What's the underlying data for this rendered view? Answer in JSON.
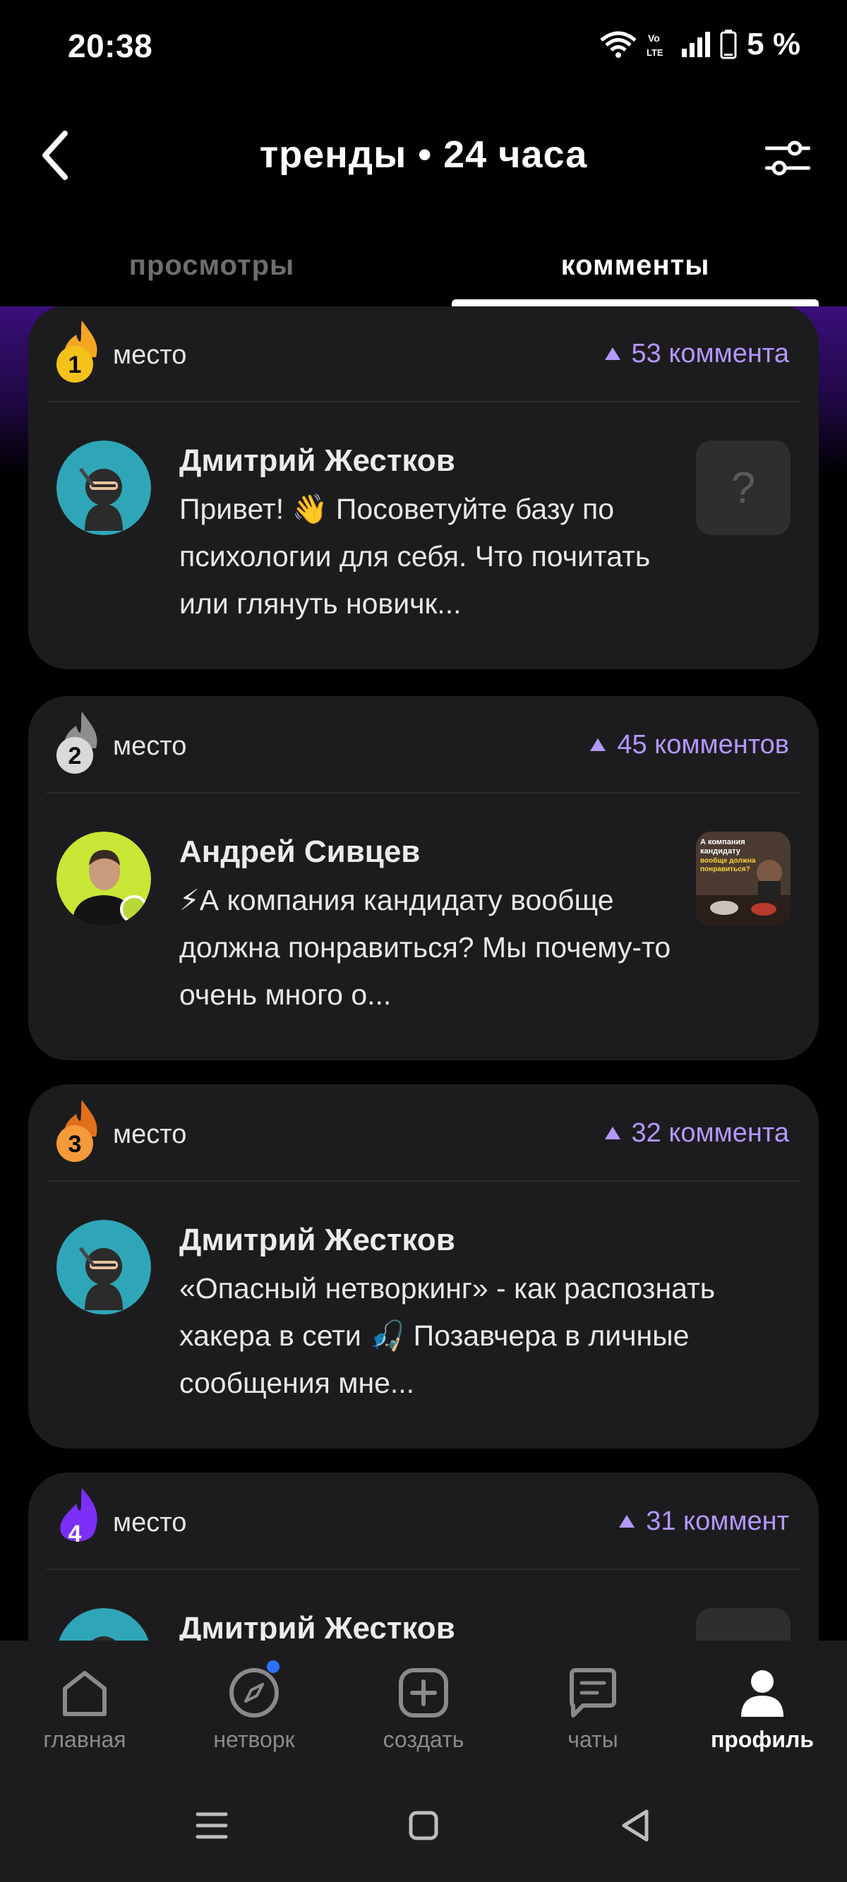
{
  "status": {
    "time": "20:38",
    "battery": "5 %",
    "network_label": "Vo LTE"
  },
  "header": {
    "title": "тренды • 24 часа"
  },
  "tabs": [
    {
      "label": "просмотры",
      "active": false
    },
    {
      "label": "комменты",
      "active": true
    }
  ],
  "place_label": "место",
  "cards": [
    {
      "rank": "1",
      "comments": "53 коммента",
      "author": "Дмитрий Жестков",
      "text": "Привет! 👋 Посоветуйте базу по психологии для себя. Что почитать или глянуть новичк...",
      "thumb": "?"
    },
    {
      "rank": "2",
      "comments": "45 комментов",
      "author": "Андрей Сивцев",
      "text": "⚡А компания кандидату вообще должна понравиться? Мы почему-то очень много о...",
      "thumb_text": "А компания кандидату вообще должна понравиться?"
    },
    {
      "rank": "3",
      "comments": "32 коммента",
      "author": "Дмитрий Жестков",
      "text": "«Опасный нетворкинг» - как распознать хакера в сети 🎣 Позавчера в личные сообщения мне..."
    },
    {
      "rank": "4",
      "comments": "31 коммент",
      "author": "Дмитрий Жестков",
      "text": ""
    }
  ],
  "nav": [
    {
      "label": "главная",
      "icon": "home-icon"
    },
    {
      "label": "нетворк",
      "icon": "compass-icon"
    },
    {
      "label": "создать",
      "icon": "plus-square-icon"
    },
    {
      "label": "чаты",
      "icon": "chat-icon"
    },
    {
      "label": "профиль",
      "icon": "profile-icon",
      "active": true
    }
  ],
  "colors": {
    "accent": "#b497ff",
    "gold": "#f5c21b",
    "silver": "#9a9a9a",
    "bronze": "#f08a24",
    "purple": "#7b2ff7"
  }
}
